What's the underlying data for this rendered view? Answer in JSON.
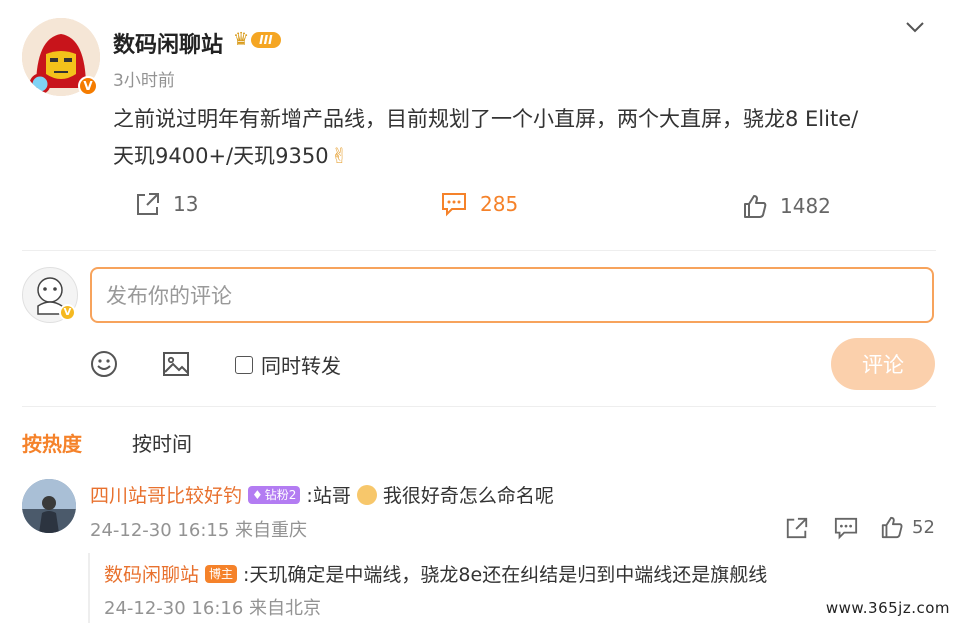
{
  "post": {
    "author": "数码闲聊站",
    "level_badge": "III",
    "time": "3小时前",
    "text_line1": "之前说过明年有新增产品线，目前规划了一个小直屏，两个大直屏，骁龙8 Elite/",
    "text_line2": "天玑9400+/天玑9350",
    "emoji": "✌",
    "repost_count": "13",
    "comment_count": "285",
    "like_count": "1482"
  },
  "composer": {
    "placeholder": "发布你的评论",
    "also_repost": "同时转发",
    "submit": "评论"
  },
  "tabs": [
    "按热度",
    "按时间"
  ],
  "comment": {
    "user": "四川站哥比较好钓",
    "fan_badge": "钻粉2",
    "text_prefix": ":站哥",
    "text_suffix": "我很好奇怎么命名呢",
    "meta": "24-12-30 16:15 来自重庆",
    "likes": "52"
  },
  "reply": {
    "user": "数码闲聊站",
    "role_badge": "博主",
    "text": ":天玑确定是中端线，骁龙8e还在纠结是归到中端线还是旗舰线",
    "meta": "24-12-30 16:16 来自北京"
  },
  "watermark": "www.365jz.com",
  "colors": {
    "accent": "#f5822a",
    "name_link": "#e8712e",
    "fan_badge": "#b37cf2"
  }
}
